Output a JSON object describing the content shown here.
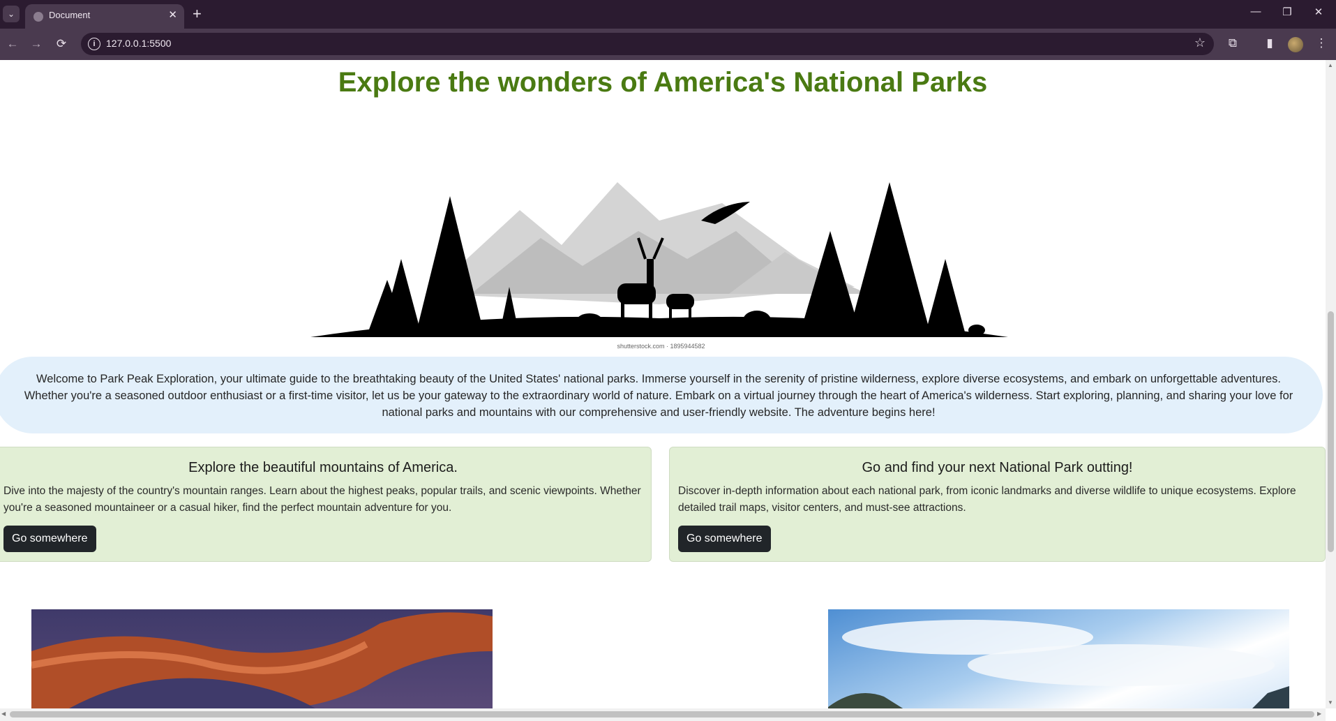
{
  "browser": {
    "tab_title": "Document",
    "url": "127.0.0.1:5500",
    "new_tab_symbol": "+",
    "tab_close_symbol": "✕"
  },
  "page": {
    "title": "Explore the wonders of America's National Parks",
    "hero_image": {
      "icon": "mountain-wildlife-silhouette",
      "caption": "shutterstock.com · 1895944582"
    },
    "welcome_text": "Welcome to Park Peak Exploration, your ultimate guide to the breathtaking beauty of the United States' national parks. Immerse yourself in the serenity of pristine wilderness, explore diverse ecosystems, and embark on unforgettable adventures. Whether you're a seasoned outdoor enthusiast or a first-time visitor, let us be your gateway to the extraordinary world of nature. Embark on a virtual journey through the heart of America's wilderness. Start exploring, planning, and sharing your love for national parks and mountains with our comprehensive and user-friendly website. The adventure begins here!",
    "cards": [
      {
        "title": "Explore the beautiful mountains of America.",
        "text": "Dive into the majesty of the country's mountain ranges. Learn about the highest peaks, popular trails, and scenic viewpoints. Whether you're a seasoned mountaineer or a casual hiker, find the perfect mountain adventure for you.",
        "button": "Go somewhere"
      },
      {
        "title": "Go and find your next National Park outting!",
        "text": "Discover in-depth information about each national park, from iconic landmarks and diverse wildlife to unique ecosystems. Explore detailed trail maps, visitor centers, and must-see attractions.",
        "button": "Go somewhere"
      }
    ],
    "photos": [
      {
        "icon": "red-rock-arch-photo"
      },
      {
        "icon": "sky-clouds-mountain-photo"
      }
    ]
  },
  "colors": {
    "title_green": "#4a7a12",
    "welcome_bg": "#e3f0fb",
    "card_bg": "#e2efd5",
    "button_dark": "#212529"
  }
}
